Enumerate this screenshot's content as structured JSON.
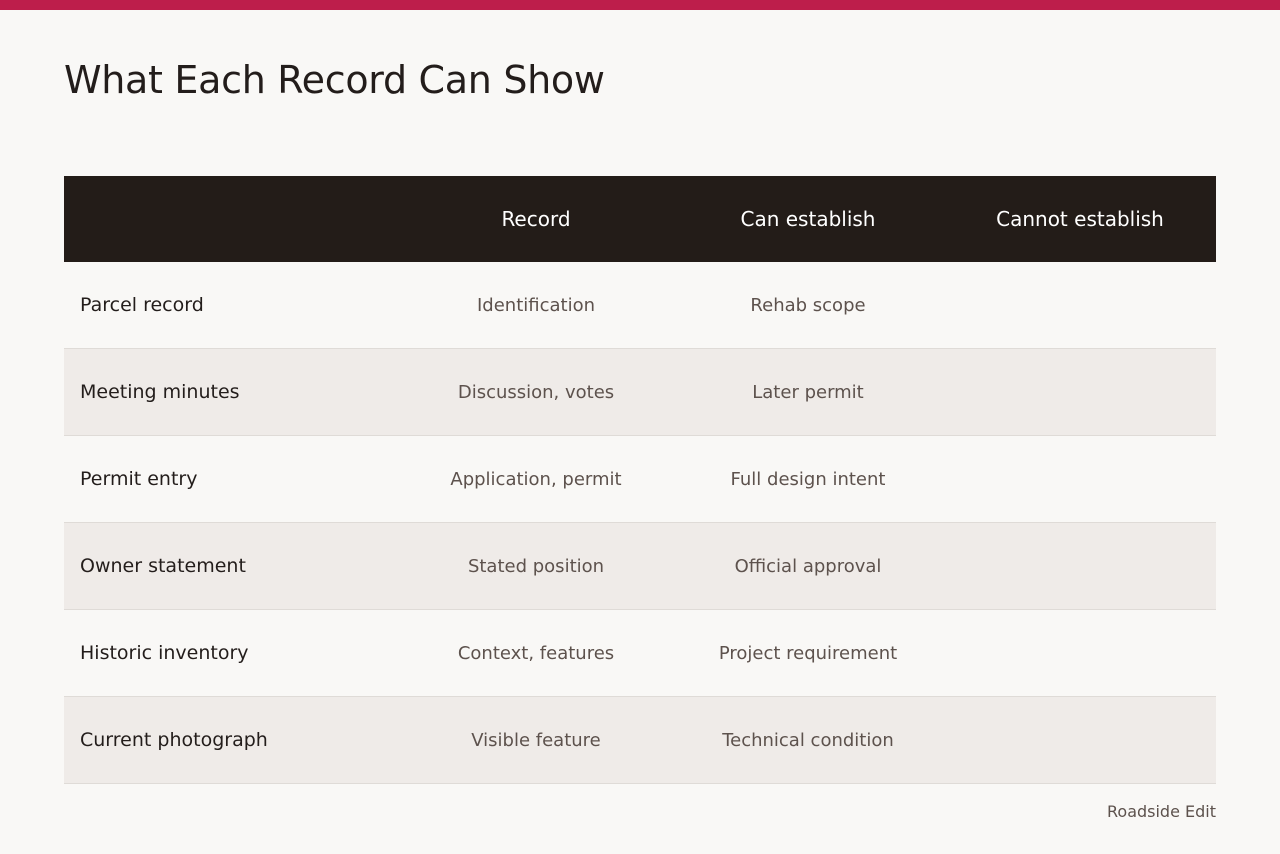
{
  "accent_color": "#bd1e4b",
  "title": "What Each Record Can Show",
  "table": {
    "headers": [
      "",
      "Record",
      "Can establish",
      "Cannot establish"
    ],
    "rows": [
      {
        "label": "Parcel record",
        "record": "Identification",
        "can_establish": "Rehab scope",
        "cannot_establish": ""
      },
      {
        "label": "Meeting minutes",
        "record": "Discussion, votes",
        "can_establish": "Later permit",
        "cannot_establish": ""
      },
      {
        "label": "Permit entry",
        "record": "Application, permit",
        "can_establish": "Full design intent",
        "cannot_establish": ""
      },
      {
        "label": "Owner statement",
        "record": "Stated position",
        "can_establish": "Official approval",
        "cannot_establish": ""
      },
      {
        "label": "Historic inventory",
        "record": "Context, features",
        "can_establish": "Project requirement",
        "cannot_establish": ""
      },
      {
        "label": "Current photograph",
        "record": "Visible feature",
        "can_establish": "Technical condition",
        "cannot_establish": ""
      }
    ]
  },
  "footer": "Roadside Edit"
}
